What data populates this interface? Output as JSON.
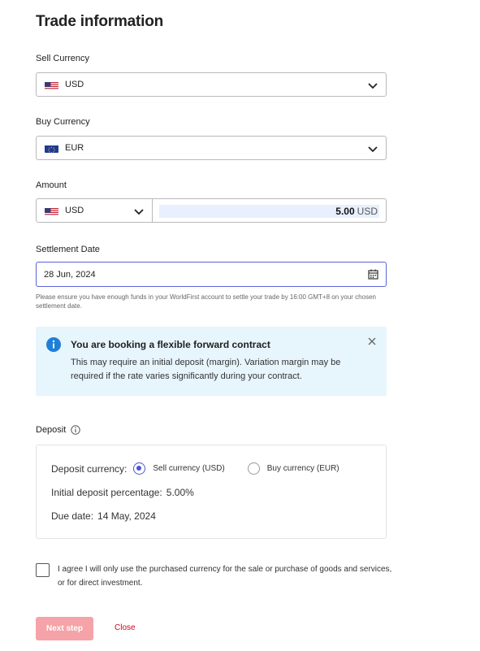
{
  "page": {
    "title": "Trade information"
  },
  "sell": {
    "label": "Sell Currency",
    "value": "USD",
    "flag": "us-flag-icon"
  },
  "buy": {
    "label": "Buy Currency",
    "value": "EUR",
    "flag": "eu-flag-icon"
  },
  "amount": {
    "label": "Amount",
    "currency": "USD",
    "value": "5.00",
    "unit": "USD"
  },
  "settlement": {
    "label": "Settlement Date",
    "value": "28 Jun, 2024",
    "hint": "Please ensure you have enough funds in your WorldFirst account to settle your trade by 16:00 GMT+8 on your chosen settlement date."
  },
  "banner": {
    "title": "You are booking a flexible forward contract",
    "body": "This may require an initial deposit (margin). Variation margin may be required if the rate varies significantly during your contract."
  },
  "deposit": {
    "label": "Deposit",
    "currency_label": "Deposit currency:",
    "options": [
      "Sell currency (USD)",
      "Buy currency (EUR)"
    ],
    "selected": "Sell currency (USD)",
    "percentage_label": "Initial deposit percentage:",
    "percentage_value": "5.00%",
    "due_label": "Due date:",
    "due_value": "14 May, 2024"
  },
  "agreement": {
    "text": "I agree I will only use the purchased currency for the sale or purchase of goods and services, or for direct investment."
  },
  "actions": {
    "next": "Next step",
    "close": "Close"
  },
  "colors": {
    "accent": "#4b56d3",
    "primary_disabled": "#f5a3a8",
    "link": "#d0021b",
    "banner_bg": "#e7f5fc",
    "info": "#1f7fd6"
  }
}
